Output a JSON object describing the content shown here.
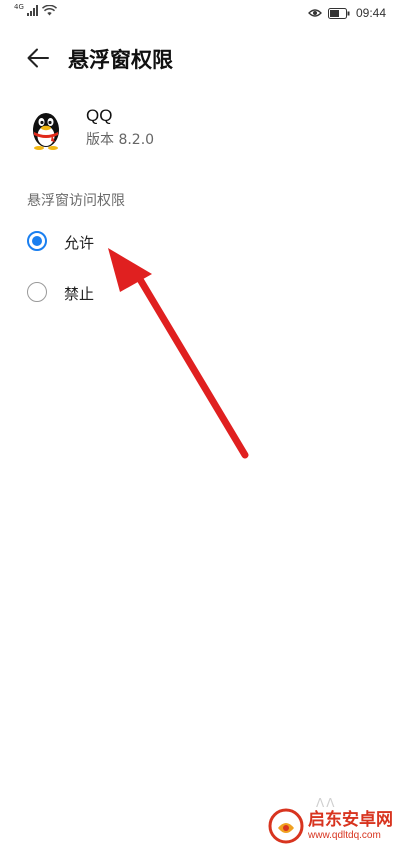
{
  "status_bar": {
    "network": "4G",
    "time": "09:44"
  },
  "header": {
    "title": "悬浮窗权限"
  },
  "app": {
    "name": "QQ",
    "version": "版本 8.2.0"
  },
  "section": {
    "label": "悬浮窗访问权限"
  },
  "options": [
    {
      "label": "允许",
      "selected": true
    },
    {
      "label": "禁止",
      "selected": false
    }
  ],
  "colors": {
    "accent": "#1a7ff0",
    "arrow": "#e02020",
    "watermark": "#d8341f"
  },
  "watermark": {
    "title": "启东安卓网",
    "url": "www.qdltdq.com"
  }
}
